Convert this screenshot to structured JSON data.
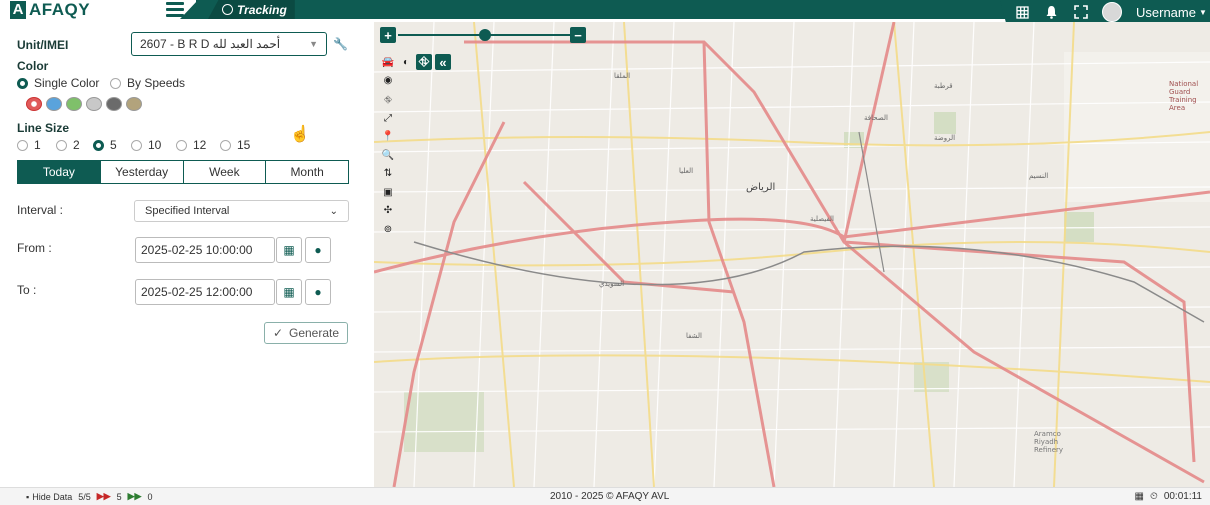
{
  "header": {
    "logo_text": "AFAQY",
    "tab_label": "Tracking",
    "username": "Username",
    "icons": [
      "grid-icon",
      "bell-icon",
      "fullscreen-icon",
      "avatar"
    ]
  },
  "form": {
    "unit_label": "Unit/IMEI",
    "unit_value": "2607 - B R D أحمد العبد لله",
    "color_label": "Color",
    "color_options": [
      "Single Color",
      "By Speeds"
    ],
    "line_size_label": "Line Size",
    "line_sizes": [
      "1",
      "2",
      "5",
      "10",
      "12",
      "15"
    ],
    "period_tabs": [
      "Today",
      "Yesterday",
      "Week",
      "Month"
    ],
    "interval_label": "Interval :",
    "interval_value": "Specified Interval",
    "from_label": "From :",
    "from_value": "2025-02-25 10:00:00",
    "to_label": "To :",
    "to_value": "2025-02-25 12:00:00",
    "generate_label": "Generate"
  },
  "map": {
    "labels": {
      "riyadh": "الرياض",
      "faisaliyah": "الفيصلية",
      "malqa": "الملقا",
      "sahafa": "الصحافة",
      "olaya": "العليا",
      "naseem": "النسيم",
      "suwaidi": "السويدي",
      "shifa": "الشفا",
      "national_guard": "National Guard Training Area",
      "aramco": "Aramco Riyadh Refinery",
      "qurtubah": "قرطبة",
      "rawdah": "الروضة"
    }
  },
  "footer": {
    "hide_data": "Hide Data",
    "count1": "5/5",
    "count2": "5",
    "count3": "0",
    "copyright": "2010 - 2025 © AFAQY AVL",
    "timer": "00:01:11"
  }
}
